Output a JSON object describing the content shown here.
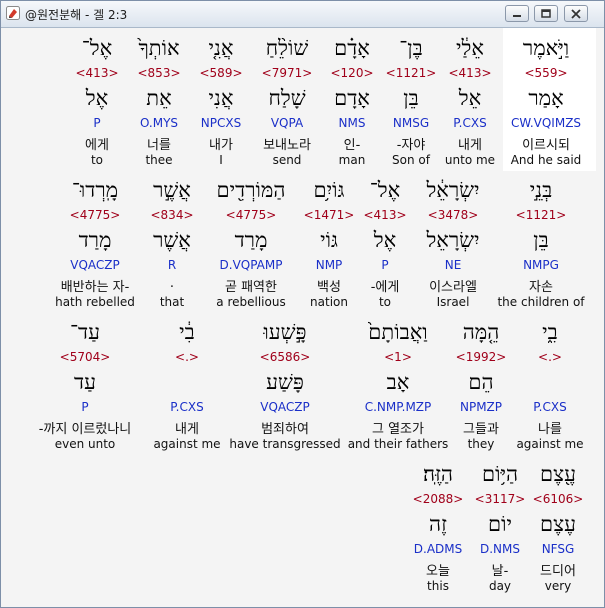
{
  "window": {
    "title": "@원전분해 - 겔 2:3",
    "controls": {
      "minimize": "minimize",
      "restore": "restore",
      "close": "close"
    }
  },
  "rows": [
    [
      {
        "hebrew": "וַיֹּ֣אמֶר",
        "strong": "<559>",
        "lemma": "אָמַר",
        "code": "CW.VQIMZS",
        "korean": "이르시되",
        "english": "And he said"
      },
      {
        "hebrew": "אֵלַ֔י",
        "strong": "<413>",
        "lemma": "אֵל",
        "code": "P.CXS",
        "korean": "내게",
        "english": "unto me"
      },
      {
        "hebrew": "בֶּן־",
        "strong": "<1121>",
        "lemma": "בֵּן",
        "code": "NMSG",
        "korean": "-자야",
        "english": "Son of"
      },
      {
        "hebrew": "אָדָ֗ם",
        "strong": "<120>",
        "lemma": "אָדָם",
        "code": "NMS",
        "korean": "인-",
        "english": "man"
      },
      {
        "hebrew": "שׁוֹלֵ֨חַ",
        "strong": "<7971>",
        "lemma": "שָׁלַח",
        "code": "VQPA",
        "korean": "보내노라",
        "english": "send"
      },
      {
        "hebrew": "אֲנִ֤י",
        "strong": "<589>",
        "lemma": "אֲנִי",
        "code": "NPCXS",
        "korean": "내가",
        "english": "I"
      },
      {
        "hebrew": "אוֹתְךָ֙",
        "strong": "<853>",
        "lemma": "אֵת",
        "code": "O.MYS",
        "korean": "너를",
        "english": "thee"
      },
      {
        "hebrew": "אֶל־",
        "strong": "<413>",
        "lemma": "אֶל",
        "code": "P",
        "korean": "에게",
        "english": "to"
      }
    ],
    [
      {
        "hebrew": "בְּנֵ֣י",
        "strong": "<1121>",
        "lemma": "בֵּן",
        "code": "NMPG",
        "korean": "자손",
        "english": "the children of"
      },
      {
        "hebrew": "יִשְׂרָאֵ֔ל",
        "strong": "<3478>",
        "lemma": "יִשְׂרָאֵל",
        "code": "NE",
        "korean": "이스라엘",
        "english": "Israel"
      },
      {
        "hebrew": "אֶל־",
        "strong": "<413>",
        "lemma": "אֶל",
        "code": "P",
        "korean": "-에게",
        "english": "to"
      },
      {
        "hebrew": "גּוֹיִ֥ם",
        "strong": "<1471>",
        "lemma": "גּוֹי",
        "code": "NMP",
        "korean": "백성",
        "english": "nation"
      },
      {
        "hebrew": "הַמּוֹרְדִ֖ים",
        "strong": "<4775>",
        "lemma": "מָרַד",
        "code": "D.VQPAMP",
        "korean": "곧 패역한",
        "english": "a rebellious"
      },
      {
        "hebrew": "אֲשֶׁ֣ר",
        "strong": "<834>",
        "lemma": "אֲשֶׁר",
        "code": "R",
        "korean": ".",
        "english": "that"
      },
      {
        "hebrew": "מָֽרְדוּ־",
        "strong": "<4775>",
        "lemma": "מָרַד",
        "code": "VQACZP",
        "korean": "배반하는 자-",
        "english": "hath rebelled"
      }
    ],
    [
      {
        "hebrew": "בִ֑י",
        "strong": "<.>",
        "lemma": "",
        "code": "P.CXS",
        "korean": "나를",
        "english": "against me"
      },
      {
        "hebrew": "הֵ֤מָּה",
        "strong": "<1992>",
        "lemma": "הֵם",
        "code": "NPMZP",
        "korean": "그들과",
        "english": "they"
      },
      {
        "hebrew": "וַאֲבוֹתָם֙",
        "strong": "<1>",
        "lemma": "אָב",
        "code": "C.NMP.MZP",
        "korean": "그 열조가",
        "english": "and their fathers"
      },
      {
        "hebrew": "פָּ֣שְׁעוּ",
        "strong": "<6586>",
        "lemma": "פָּשַׁע",
        "code": "VQACZP",
        "korean": "범죄하여",
        "english": "have transgressed"
      },
      {
        "hebrew": "בִ֔י",
        "strong": "<.>",
        "lemma": "",
        "code": "P.CXS",
        "korean": "내게",
        "english": "against me"
      },
      {
        "hebrew": "עַד־",
        "strong": "<5704>",
        "lemma": "עַד",
        "code": "P",
        "korean": "-까지 이르렀나니",
        "english": "even unto"
      }
    ],
    [
      {
        "hebrew": "עֶ֖צֶם",
        "strong": "<6106>",
        "lemma": "עֶצֶם",
        "code": "NFSG",
        "korean": "드디어",
        "english": "very"
      },
      {
        "hebrew": "הַיּ֥וֹם",
        "strong": "<3117>",
        "lemma": "יוֹם",
        "code": "D.NMS",
        "korean": "날-",
        "english": "day"
      },
      {
        "hebrew": "הַזֶּֽה׃",
        "strong": "<2088>",
        "lemma": "זֶה",
        "code": "D.ADMS",
        "korean": "오늘",
        "english": "this"
      }
    ]
  ]
}
